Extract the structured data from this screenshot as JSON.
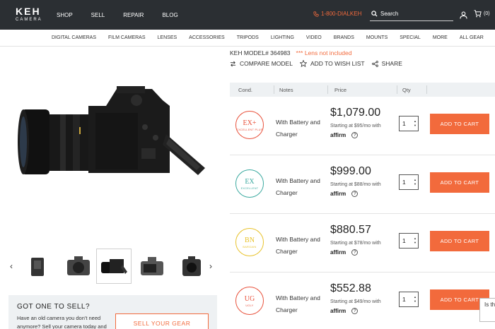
{
  "header": {
    "logo_top": "KEH",
    "logo_bottom": "CAMERA",
    "nav": [
      "SHOP",
      "SELL",
      "REPAIR",
      "BLOG"
    ],
    "phone": "1-800-DIALKEH",
    "search_placeholder": "Search",
    "cart_count": "(0)"
  },
  "categories": [
    "DIGITAL CAMERAS",
    "FILM CAMERAS",
    "LENSES",
    "ACCESSORIES",
    "TRIPODS",
    "LIGHTING",
    "VIDEO",
    "BRANDS",
    "MOUNTS",
    "SPECIAL",
    "MORE",
    "ALL GEAR"
  ],
  "product": {
    "model": "KEH MODEL# 364983",
    "warning": "*** Lens not included",
    "actions": [
      "COMPARE MODEL",
      "ADD TO WISH LIST",
      "SHARE"
    ]
  },
  "table": {
    "headers": [
      "Cond.",
      "Notes",
      "Price",
      "Qty"
    ],
    "rows": [
      {
        "code": "EX+",
        "cond_name": "EXCELLENT PLUS",
        "color": "#e8503a",
        "notes": "With Battery and Charger",
        "price": "$1,079.00",
        "financing": "Starting at $95/mo with",
        "affirm": "affirm",
        "qty": "1",
        "button": "ADD TO CART"
      },
      {
        "code": "EX",
        "cond_name": "EXCELLENT",
        "color": "#3aa99f",
        "notes": "With Battery and Charger",
        "price": "$999.00",
        "financing": "Starting at $88/mo with",
        "affirm": "affirm",
        "qty": "1",
        "button": "ADD TO CART"
      },
      {
        "code": "BN",
        "cond_name": "BARGAIN",
        "color": "#e8c22a",
        "notes": "With Battery and Charger",
        "price": "$880.57",
        "financing": "Starting at $78/mo with",
        "affirm": "affirm",
        "qty": "1",
        "button": "ADD TO CART"
      },
      {
        "code": "UG",
        "cond_name": "UGLY",
        "color": "#e8503a",
        "notes": "With Battery and Charger",
        "price": "$552.88",
        "financing": "Starting at $49/mo with",
        "affirm": "affirm",
        "qty": "1",
        "button": "ADD TO CART"
      }
    ]
  },
  "sell": {
    "title": "GOT ONE TO SELL?",
    "text": "Have an old camera you don't need anymore? Sell your camera today and",
    "button": "SELL YOUR GEAR"
  },
  "chat_text": "Is th you",
  "colors": {
    "accent": "#f26a3c",
    "header_bg": "#2b2f33"
  }
}
